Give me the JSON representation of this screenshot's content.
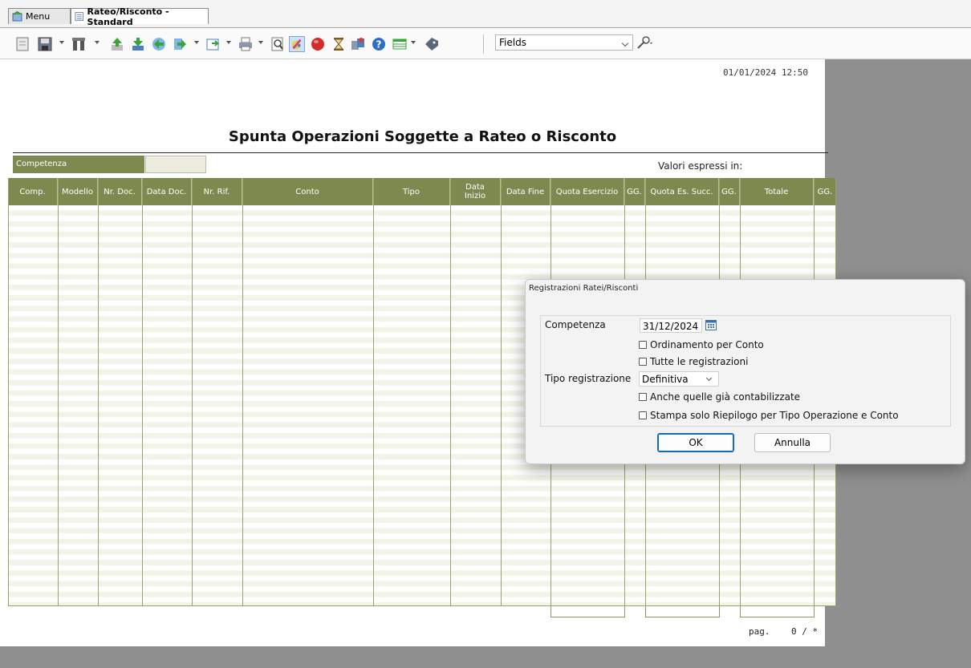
{
  "tabs": [
    {
      "label": "Menu",
      "icon": "menu-home-icon",
      "active": false
    },
    {
      "label": "Rateo/Risconto - Standard",
      "icon": "report-icon",
      "active": true
    }
  ],
  "toolbar": {
    "fields_select": "Fields",
    "icons": [
      "new-doc-icon",
      "save-icon",
      "tools-icon",
      "up-arrow-icon",
      "down-arrow-icon",
      "back-arrow-icon",
      "forward-arrow-icon",
      "export-icon",
      "print-icon",
      "preview-icon",
      "paint-icon",
      "stop-icon",
      "hourglass-icon",
      "sync-icon",
      "help-icon",
      "grid-icon",
      "tag-icon",
      "wrench-icon"
    ]
  },
  "report": {
    "timestamp": "01/01/2024 12:50",
    "title": "Spunta Operazioni Soggette a Rateo o Risconto",
    "competenza_label": "Competenza",
    "valori_label": "Valori espressi in:",
    "columns": [
      "Comp.",
      "Modello",
      "Nr. Doc.",
      "Data Doc.",
      "Nr. Rif.",
      "Conto",
      "Tipo",
      "Data Inizio",
      "Data Fine",
      "Quota Esercizio",
      "GG.",
      "Quota Es. Succ.",
      "GG.",
      "Totale",
      "GG."
    ],
    "page_label": "pag.",
    "page_value": "0 / *"
  },
  "dialog": {
    "title": "Registrazioni Ratei/Risconti",
    "competenza_label": "Competenza",
    "competenza_value": "31/12/2024",
    "ordinamento_label": "Ordinamento per Conto",
    "tutte_label": "Tutte le registrazioni",
    "tipo_label": "Tipo registrazione",
    "tipo_value": "Definitiva",
    "anche_label": "Anche quelle già contabilizzate",
    "stampa_label": "Stampa solo Riepilogo per Tipo Operazione e Conto",
    "ok_label": "OK",
    "annulla_label": "Annulla"
  },
  "colors": {
    "header_olive": "#7d8a4f",
    "stripe": "#f2f3e9",
    "accent_blue": "#0f6cbd"
  }
}
